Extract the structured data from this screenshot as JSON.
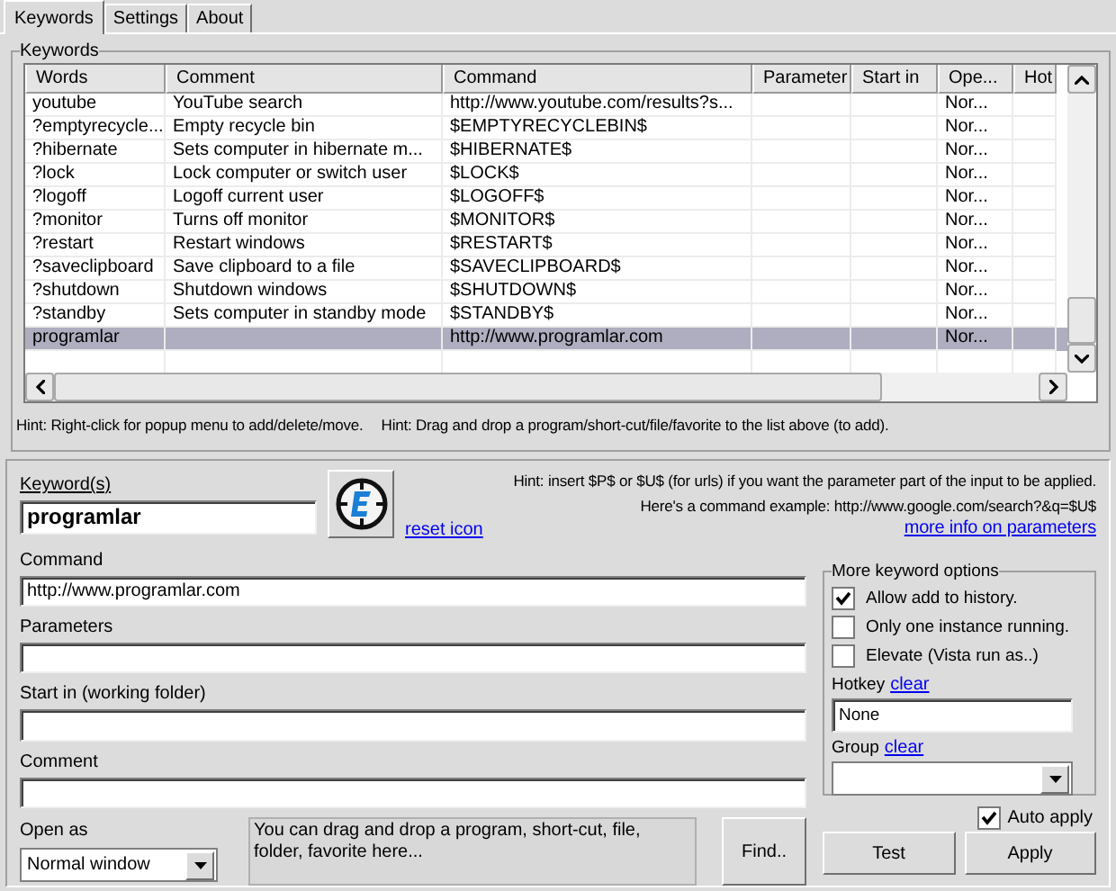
{
  "tabs": [
    {
      "label": "Keywords",
      "selected": true
    },
    {
      "label": "Settings",
      "selected": false
    },
    {
      "label": "About",
      "selected": false
    }
  ],
  "keywords_group": {
    "title": "Keywords",
    "columns": [
      "Words",
      "Comment",
      "Command",
      "Parameter",
      "Start in",
      "Ope...",
      "Hot"
    ],
    "rows": [
      {
        "words": "youtube",
        "comment": "YouTube search",
        "command": "http://www.youtube.com/results?s...",
        "open_as": "Nor...",
        "selected": false
      },
      {
        "words": "?emptyrecycle...",
        "comment": "Empty recycle bin",
        "command": "$EMPTYRECYCLEBIN$",
        "open_as": "Nor...",
        "selected": false
      },
      {
        "words": "?hibernate",
        "comment": "Sets computer in hibernate m...",
        "command": "$HIBERNATE$",
        "open_as": "Nor...",
        "selected": false
      },
      {
        "words": "?lock",
        "comment": "Lock computer or switch user",
        "command": "$LOCK$",
        "open_as": "Nor...",
        "selected": false
      },
      {
        "words": "?logoff",
        "comment": "Logoff current user",
        "command": "$LOGOFF$",
        "open_as": "Nor...",
        "selected": false
      },
      {
        "words": "?monitor",
        "comment": "Turns off monitor",
        "command": "$MONITOR$",
        "open_as": "Nor...",
        "selected": false
      },
      {
        "words": "?restart",
        "comment": "Restart windows",
        "command": "$RESTART$",
        "open_as": "Nor...",
        "selected": false
      },
      {
        "words": "?saveclipboard",
        "comment": "Save clipboard to a file",
        "command": "$SAVECLIPBOARD$",
        "open_as": "Nor...",
        "selected": false
      },
      {
        "words": "?shutdown",
        "comment": "Shutdown windows",
        "command": "$SHUTDOWN$",
        "open_as": "Nor...",
        "selected": false
      },
      {
        "words": "?standby",
        "comment": "Sets computer in standby mode",
        "command": "$STANDBY$",
        "open_as": "Nor...",
        "selected": false
      },
      {
        "words": "programlar",
        "command": "http://www.programlar.com",
        "open_as": "Nor...",
        "selected": true
      }
    ],
    "hints": [
      "Hint: Right-click for popup menu to add/delete/move.",
      "Hint: Drag and drop a program/short-cut/file/favorite to the list above (to add)."
    ]
  },
  "editor": {
    "keyword": {
      "label": "Keyword(s)",
      "value": "programlar"
    },
    "reset_link": "reset icon",
    "hint_lines": [
      "Hint: insert $P$ or $U$ (for urls) if you want the parameter part of the input to be applied.",
      "Here's a command example: http://www.google.com/search?&q=$U$"
    ],
    "more_info_link": "more info on parameters",
    "fields": [
      {
        "label": "Command",
        "value": "http://www.programlar.com"
      },
      {
        "label": "Parameters"
      },
      {
        "label": "Start in (working folder)"
      },
      {
        "label": "Comment"
      }
    ],
    "open_as": {
      "label": "Open as",
      "value": "Normal window"
    },
    "drop_area": "You can drag and drop a program, short-cut, file, folder, favorite here...",
    "find_button": "Find..",
    "options": {
      "title": "More keyword options",
      "checkboxes": [
        {
          "label": "Allow add to history.",
          "checked": true
        },
        {
          "label": "Only one instance running.",
          "checked": false
        },
        {
          "label": "Elevate (Vista run as..)",
          "checked": false
        }
      ],
      "hotkey": {
        "label": "Hotkey",
        "clear_link": "clear",
        "value": "None"
      },
      "group": {
        "label": "Group",
        "clear_link": "clear"
      }
    },
    "auto_apply": {
      "label": "Auto apply",
      "checked": true
    },
    "buttons": [
      "Test",
      "Apply"
    ]
  }
}
